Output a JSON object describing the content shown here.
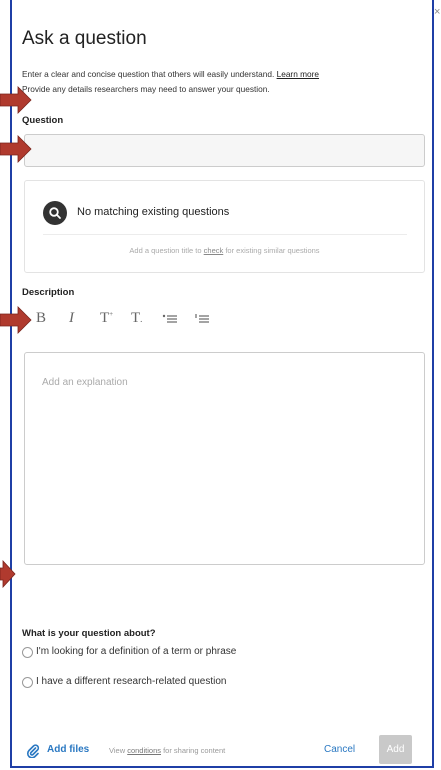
{
  "dialog": {
    "title": "Ask a question",
    "intro_line1": "Enter a clear and concise question that others will easily understand.",
    "learn_more": "Learn more",
    "intro_line2": "Provide any details researchers may need to answer your question.",
    "close_glyph": "×"
  },
  "question": {
    "label": "Question",
    "value": ""
  },
  "matching": {
    "title": "No matching existing questions",
    "hint_before": "Add a question title to",
    "hint_link": "check",
    "hint_after": "for existing similar questions"
  },
  "description": {
    "label": "Description",
    "toolbar": {
      "bold": "B",
      "italic": "I",
      "heading": "T",
      "heading_sup": "+",
      "small": "T",
      "bullet_list": "•☰",
      "numbered_list": "¹☰"
    },
    "placeholder": "Add an explanation"
  },
  "about": {
    "label": "What is your question about?",
    "options": [
      "I'm looking for a definition of a term or phrase",
      "I have a different research-related question"
    ]
  },
  "footer": {
    "add_files": "Add files",
    "view_before": "View",
    "view_link": "conditions",
    "view_after": "for sharing content",
    "cancel": "Cancel",
    "add": "Add"
  },
  "colors": {
    "frame_border": "#1f3fa6",
    "link_blue": "#2a78c2",
    "arrow_red": "#b03a2e"
  }
}
